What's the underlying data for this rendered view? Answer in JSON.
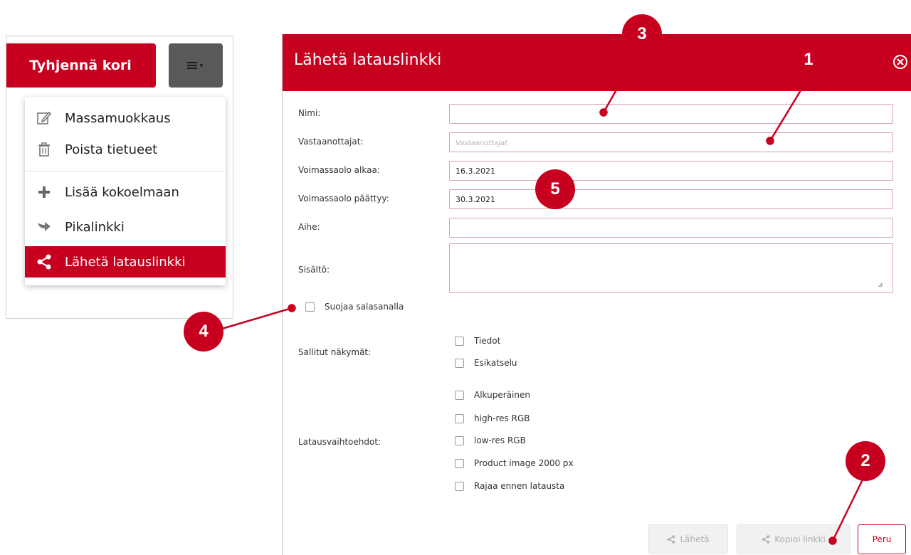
{
  "cart": {
    "clear_button": "Tyhjennä kori"
  },
  "dropdown": {
    "items": [
      {
        "label": "Massamuokkaus",
        "icon": "edit-icon"
      },
      {
        "label": "Poista tietueet",
        "icon": "trash-icon"
      },
      {
        "label": "Lisää kokoelmaan",
        "icon": "plus-icon"
      },
      {
        "label": "Pikalinkki",
        "icon": "quick-link-icon"
      },
      {
        "label": "Lähetä latauslinkki",
        "icon": "share-icon",
        "active": true
      }
    ]
  },
  "dialog": {
    "title": "Lähetä latauslinkki",
    "fields": {
      "name": {
        "label": "Nimi:",
        "value": ""
      },
      "recipients": {
        "label": "Vastaanottajat:",
        "placeholder": "Vastaanottajat",
        "value": ""
      },
      "valid_from": {
        "label": "Voimassaolo alkaa:",
        "value": "16.3.2021"
      },
      "valid_to": {
        "label": "Voimassaolo päättyy:",
        "value": "30.3.2021"
      },
      "subject": {
        "label": "Aihe:",
        "value": ""
      },
      "content": {
        "label": "Sisältö:",
        "value": ""
      }
    },
    "protect_password": "Suojaa salasanalla",
    "allowed_views": {
      "label": "Sallitut näkymät:",
      "options": [
        "Tiedot",
        "Esikatselu"
      ]
    },
    "download_options": {
      "label": "Latausvaihtoehdot:",
      "options": [
        "Alkuperäinen",
        "high-res RGB",
        "low-res RGB",
        "Product image 2000 px",
        "Rajaa ennen latausta"
      ]
    },
    "buttons": {
      "send": "Lähetä",
      "copy_link": "Kopioi linkki",
      "cancel": "Peru"
    }
  },
  "callouts": [
    "1",
    "2",
    "3",
    "4",
    "5"
  ],
  "colors": {
    "brand_red": "#c8001f",
    "field_border": "#d9a3ab",
    "dark_button": "#595959"
  }
}
